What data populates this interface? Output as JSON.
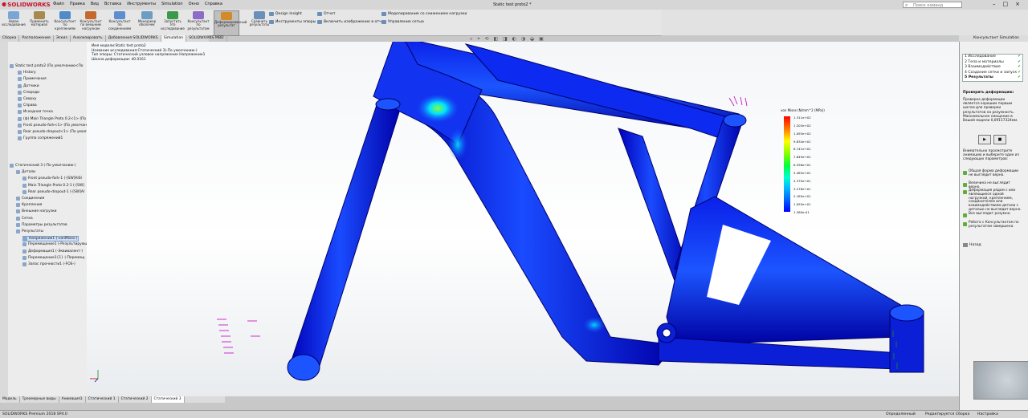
{
  "app": {
    "logo_text": "SOLIDWORKS",
    "document_title": "Static test proto2 *"
  },
  "menu": [
    "Файл",
    "Правка",
    "Вид",
    "Вставка",
    "Инструменты",
    "Simulation",
    "Окно",
    "Справка"
  ],
  "search": {
    "placeholder": "Поиск команд"
  },
  "ribbon": {
    "large_buttons": [
      {
        "label": "Новое исследование"
      },
      {
        "label": "Применить материал"
      },
      {
        "label": "Консультант по креплениям"
      },
      {
        "label": "Консультант по внешним нагрузкам"
      },
      {
        "label": "Консультант по соединениям"
      },
      {
        "label": "Менеджер оболочек"
      },
      {
        "label": "Запустить это исследование"
      },
      {
        "label": "Консультант по результатам"
      },
      {
        "label": "Деформированный результат"
      },
      {
        "label": "Сравнить результаты"
      }
    ],
    "small_buttons": [
      {
        "label": "Design Insight"
      },
      {
        "label": "Инструменты эпюры"
      },
      {
        "label": "Отчет"
      },
      {
        "label": "Включить изображение в отчет"
      },
      {
        "label": "Моделирование со снижением нагрузки"
      },
      {
        "label": "Управление сетью"
      }
    ]
  },
  "tabs": [
    "Сборка",
    "Расположение",
    "Эскиз",
    "Анализировать",
    "Добавления SOLIDWORKS",
    "Simulation",
    "SOLIDWORKS MBD"
  ],
  "active_tab": "Simulation",
  "tree_top": [
    "Static test proto2 (По умолчанию<По",
    "History",
    "Примечания",
    "Датчики",
    "Спереди",
    "Сверху",
    "Справа",
    "Исходная точка",
    "(ф) Main Triangle Proto 0.2<1> (По",
    "Front pseudo-fork<1> (По умолчан",
    "Rear pseudo-dropout<1> (По умолча",
    "Группа сопряжений1"
  ],
  "tree_study": [
    "Статический 3 (-По умолчанию-)",
    "Детали",
    "Front pseudo-fork-1 (-[SW]AISI",
    "Main Triangle Proto 0.2-1 (-[SW]",
    "Rear pseudo-dropout-1 (-[SW]AI",
    "Соединения",
    "Крепления",
    "Внешние нагрузки",
    "Сетка",
    "Параметры результатов",
    "Результаты",
    "Напряжение1 (-vonMises-)",
    "Перемещение1 (-Результирующ",
    "Деформация1 (-Эквивалент-)",
    "Перемещение1{1} (-Перемещ",
    "Запас прочности1 (-FOS-)"
  ],
  "bottom_tabs": [
    "Модель",
    "Трехмерные виды",
    "Анимация1",
    "Статический 1",
    "Статический 2",
    "Статический 3"
  ],
  "viewport_info": [
    "Имя модели:Static test proto2",
    "Название исследования:Статический 3(-По умолчанию-)",
    "Тип эпюры: Статический узловое напряжение Напряжение1",
    "Шкала деформации: 40.0161"
  ],
  "legend": {
    "title": "von Mises (N/mm^2 (MPa))",
    "ticks": [
      "1.311e+02",
      "1.203e+02",
      "1.093e+02",
      "9.834e+01",
      "8.741e+01",
      "7.649e+01",
      "6.556e+01",
      "5.463e+01",
      "4.370e+01",
      "3.278e+01",
      "2.185e+01",
      "1.093e+01",
      "1.360e-01"
    ]
  },
  "right_panel": {
    "title": "Консультант Simulation",
    "steps": [
      {
        "num": "1",
        "label": "Исследование",
        "done": true
      },
      {
        "num": "2",
        "label": "Тела и материалы",
        "done": true
      },
      {
        "num": "3",
        "label": "Взаимодействие",
        "done": true
      },
      {
        "num": "4",
        "label": "Создание сетки и запуск",
        "done": true
      },
      {
        "num": "5",
        "label": "Результаты",
        "done": true
      }
    ],
    "heading": "Проверить деформацию:",
    "body": "Проверка деформации является хорошим первым шагом для проверки результатов на разумность. Максимальное смещение в Вашей модели 0,09157324мм.",
    "hint": "Внимательно просмотрите анимацию и выберите один из следующих параметров:",
    "options": [
      "Общая форма деформации не выглядит верно.",
      "Величина не выглядит верно.",
      "Деформация рядом с или являющиеся одной нагрузкой, креплением, соединителем или взаимодействием детали с деталью не выглядит верно.",
      "Все выглядит разумно.",
      "Работа с Консультантом по результатам завершена."
    ],
    "back_label": "Назад"
  },
  "status": {
    "product": "SOLIDWORKS Premium 2018 SP4.0",
    "state": "Определенный",
    "mode": "Редактируется Сборка",
    "custom": "Настройка"
  },
  "colors": {
    "logo": "#c8102e",
    "frame": "#0a1fd6",
    "highlight": "#2fd0ff",
    "check": "#1f9a2a"
  }
}
